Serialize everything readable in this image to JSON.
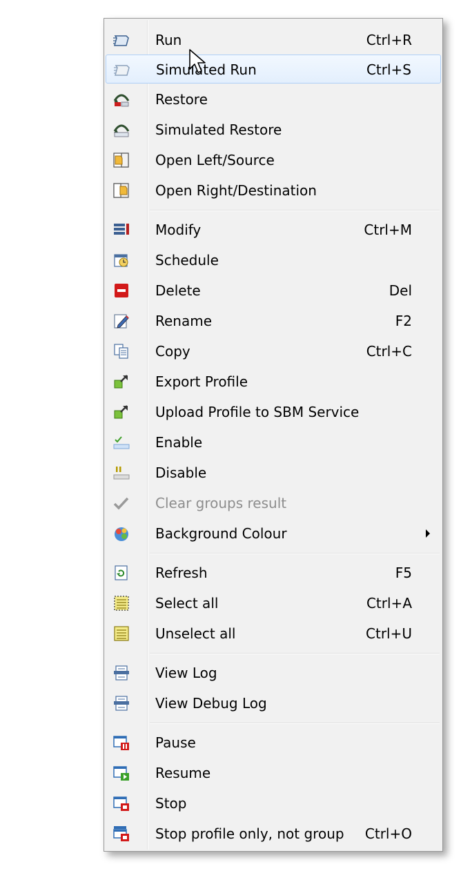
{
  "menu": {
    "items": [
      {
        "label": "Run",
        "shortcut": "Ctrl+R",
        "icon": "run-icon"
      },
      {
        "label": "Simulated Run",
        "shortcut": "Ctrl+S",
        "icon": "simulated-run-icon"
      },
      {
        "label": "Restore",
        "shortcut": "",
        "icon": "restore-icon"
      },
      {
        "label": "Simulated Restore",
        "shortcut": "",
        "icon": "simulated-restore-icon"
      },
      {
        "label": "Open Left/Source",
        "shortcut": "",
        "icon": "open-left-icon"
      },
      {
        "label": "Open Right/Destination",
        "shortcut": "",
        "icon": "open-right-icon"
      },
      {
        "label": "Modify",
        "shortcut": "Ctrl+M",
        "icon": "modify-icon"
      },
      {
        "label": "Schedule",
        "shortcut": "",
        "icon": "schedule-icon"
      },
      {
        "label": "Delete",
        "shortcut": "Del",
        "icon": "delete-icon"
      },
      {
        "label": "Rename",
        "shortcut": "F2",
        "icon": "rename-icon"
      },
      {
        "label": "Copy",
        "shortcut": "Ctrl+C",
        "icon": "copy-icon"
      },
      {
        "label": "Export Profile",
        "shortcut": "",
        "icon": "export-icon"
      },
      {
        "label": "Upload Profile to SBM Service",
        "shortcut": "",
        "icon": "upload-icon"
      },
      {
        "label": "Enable",
        "shortcut": "",
        "icon": "enable-icon"
      },
      {
        "label": "Disable",
        "shortcut": "",
        "icon": "disable-icon"
      },
      {
        "label": "Clear groups result",
        "shortcut": "",
        "icon": "checkmark-icon"
      },
      {
        "label": "Background Colour",
        "shortcut": "",
        "icon": "palette-icon"
      },
      {
        "label": "Refresh",
        "shortcut": "F5",
        "icon": "refresh-icon"
      },
      {
        "label": "Select all",
        "shortcut": "Ctrl+A",
        "icon": "select-all-icon"
      },
      {
        "label": "Unselect all",
        "shortcut": "Ctrl+U",
        "icon": "unselect-all-icon"
      },
      {
        "label": "View Log",
        "shortcut": "",
        "icon": "view-log-icon"
      },
      {
        "label": "View Debug Log",
        "shortcut": "",
        "icon": "view-debug-log-icon"
      },
      {
        "label": "Pause",
        "shortcut": "",
        "icon": "pause-icon"
      },
      {
        "label": "Resume",
        "shortcut": "",
        "icon": "resume-icon"
      },
      {
        "label": "Stop",
        "shortcut": "",
        "icon": "stop-icon"
      },
      {
        "label": "Stop profile only, not group",
        "shortcut": "Ctrl+O",
        "icon": "stop-profile-icon"
      }
    ],
    "highlighted": "Simulated Run",
    "disabled": [
      "Clear groups result"
    ],
    "submenu": [
      "Background Colour"
    ]
  },
  "colors": {
    "highlight_border": "#aecff7",
    "menu_bg": "#f1f1f1",
    "disabled_text": "#8d8d8d"
  }
}
